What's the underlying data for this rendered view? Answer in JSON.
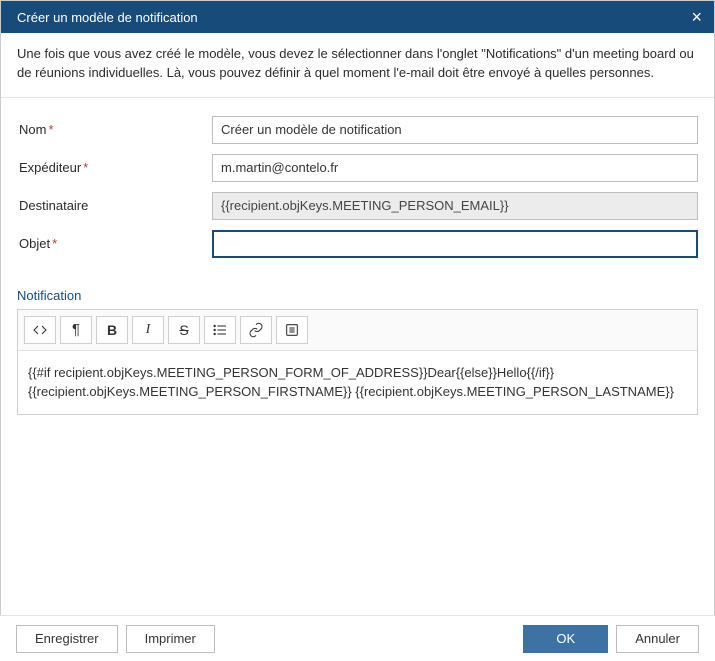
{
  "title": "Créer un modèle de notification",
  "description": "Une fois que vous avez créé le modèle, vous devez le sélectionner dans l'onglet \"Notifications\" d'un meeting board ou de réunions individuelles. Là, vous pouvez définir à quel moment l'e-mail doit être envoyé à quelles personnes.",
  "form": {
    "name": {
      "label": "Nom",
      "value": "Créer un modèle de notification",
      "required": true
    },
    "sender": {
      "label": "Expéditeur",
      "value": "m.martin@contelo.fr",
      "required": true
    },
    "recipient": {
      "label": "Destinataire",
      "value": "{{recipient.objKeys.MEETING_PERSON_EMAIL}}",
      "required": false
    },
    "subject": {
      "label": "Objet",
      "value": "",
      "required": true
    }
  },
  "sectionLabel": "Notification",
  "editor": {
    "line1": "{{#if recipient.objKeys.MEETING_PERSON_FORM_OF_ADDRESS}}Dear{{else}}Hello{{/if}}",
    "line2": "{{recipient.objKeys.MEETING_PERSON_FIRSTNAME}} {{recipient.objKeys.MEETING_PERSON_LASTNAME}}"
  },
  "toolbar": {
    "code": "< >",
    "paragraph": "¶",
    "bold": "B",
    "italic": "I",
    "strike": "S"
  },
  "footer": {
    "save": "Enregistrer",
    "print": "Imprimer",
    "ok": "OK",
    "cancel": "Annuler"
  }
}
